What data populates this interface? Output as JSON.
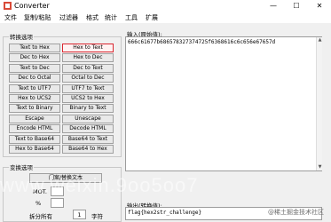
{
  "window": {
    "title": "Converter",
    "minimize": "—",
    "maximize": "☐",
    "close": "✕"
  },
  "menu": [
    "文件",
    "复制/粘贴",
    "过滤器",
    "格式",
    "统计",
    "工具",
    "扩展"
  ],
  "convert_group": {
    "label": "转换选项"
  },
  "buttons": [
    [
      "Text to Hex",
      "Hex to Text"
    ],
    [
      "Dec to Hex",
      "Hex to Dec"
    ],
    [
      "Text to Dec",
      "Dec to Text"
    ],
    [
      "Dec to Octal",
      "Octal to Dec"
    ],
    [
      "Text to UTF7",
      "UTF7 to Text"
    ],
    [
      "Hex to UCS2",
      "UCS2 to Hex"
    ],
    [
      "Text to Binary",
      "Binary to Text"
    ],
    [
      "Escape",
      "Unescape"
    ],
    [
      "Encode HTML",
      "Decode HTML"
    ],
    [
      "Text to Base64",
      "Base64 to Text"
    ],
    [
      "Hex to Base64",
      "Base64 to Hex"
    ]
  ],
  "selected_button": "Hex to Text",
  "input": {
    "label": "输入(原始值):",
    "value": "666c61677b686578327374725f6368616c6c656e67657d"
  },
  "output": {
    "label": "输出(转换值):",
    "value": "flag{hex2str_challenge}"
  },
  "transform_group": {
    "label": "变换选项"
  },
  "replace_button": "门案/替换文本",
  "row1": {
    "label": "MOT.",
    "value": ""
  },
  "row2": {
    "label": "%",
    "value": ""
  },
  "split": {
    "label": "拆分所有",
    "value": "1",
    "suffix": "字符"
  },
  "watermark": "www.weixin.9oo5oo7",
  "credit": "@稀土掘金技术社区"
}
